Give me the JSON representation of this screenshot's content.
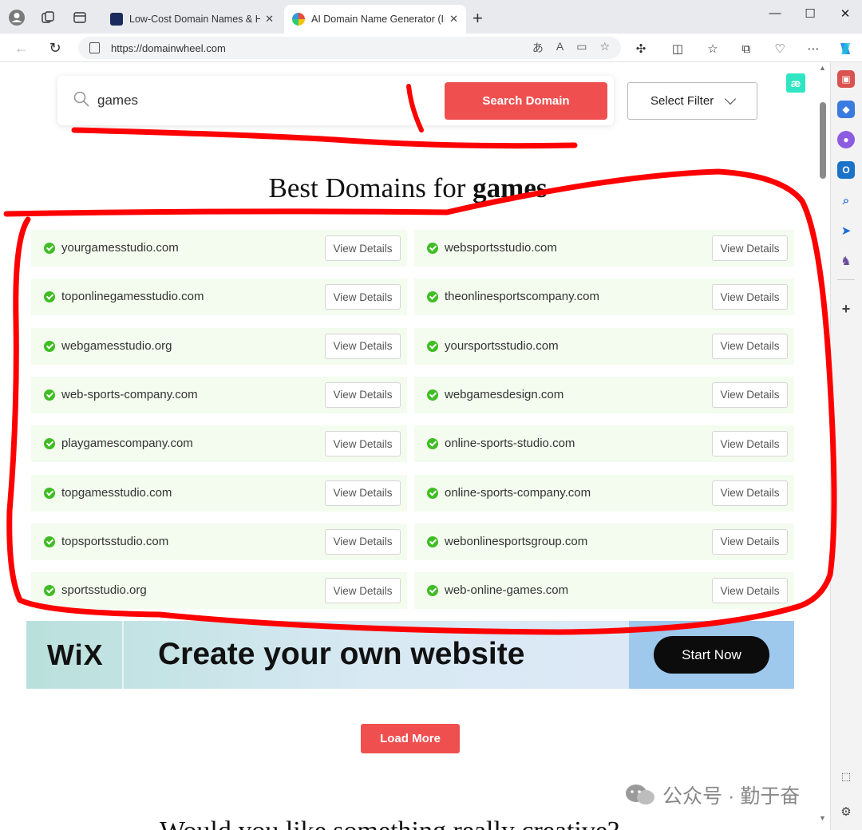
{
  "browser": {
    "tabs": [
      {
        "title": "Low-Cost Domain Names & Hosting",
        "active": false
      },
      {
        "title": "AI Domain Name Generator (Instant",
        "active": true
      }
    ],
    "url": "https://domainwheel.com",
    "new_tab_symbol": "+",
    "tab_close_symbol": "✕"
  },
  "page": {
    "search": {
      "query": "games",
      "button_label": "Search Domain"
    },
    "filter_label": "Select Filter",
    "badge_label": "æ",
    "heading_prefix": "Best Domains for ",
    "heading_keyword": "games",
    "view_details_label": "View Details",
    "results_left": [
      "yourgamesstudio.com",
      "toponlinegamesstudio.com",
      "webgamesstudio.org",
      "web-sports-company.com",
      "playgamescompany.com",
      "topgamesstudio.com",
      "topsportsstudio.com",
      "sportsstudio.org"
    ],
    "results_right": [
      "websportsstudio.com",
      "theonlinesportscompany.com",
      "yoursportsstudio.com",
      "webgamesdesign.com",
      "online-sports-studio.com",
      "online-sports-company.com",
      "webonlinesportsgroup.com",
      "web-online-games.com"
    ],
    "ad": {
      "brand": "WiX",
      "tagline": "Create your own  website",
      "cta": "Start Now"
    },
    "load_more_label": "Load More",
    "next_heading": "Would you like something really creative?",
    "watermark": "公众号 · 勤于奋"
  },
  "colors": {
    "accent": "#ef4f4f",
    "result_bg": "#f3fcee",
    "check": "#3fbd24",
    "annotation": "#ff0000"
  }
}
